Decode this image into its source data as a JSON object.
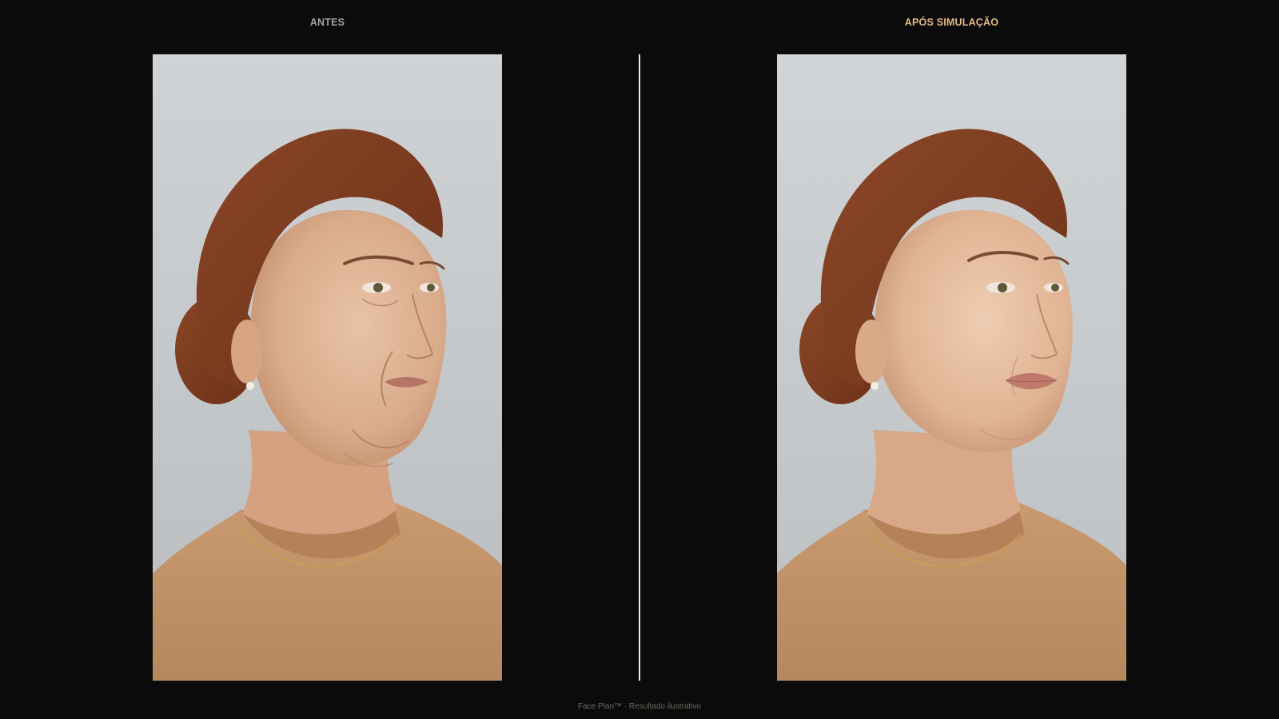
{
  "labels": {
    "before": "ANTES",
    "after": "APÓS SIMULAÇÃO"
  },
  "footer": {
    "text": "Face Plan™ · Resultado ilustrativo"
  },
  "colors": {
    "background": "#0b0b0c",
    "accent": "#e3b985",
    "label_muted": "#a2a2a2",
    "divider": "#e8e8e8",
    "sweater": "#c4946a",
    "hair": "#7a3a1e"
  },
  "images": {
    "before": {
      "description_icon": "portrait-before-icon"
    },
    "after": {
      "description_icon": "portrait-after-icon"
    }
  }
}
